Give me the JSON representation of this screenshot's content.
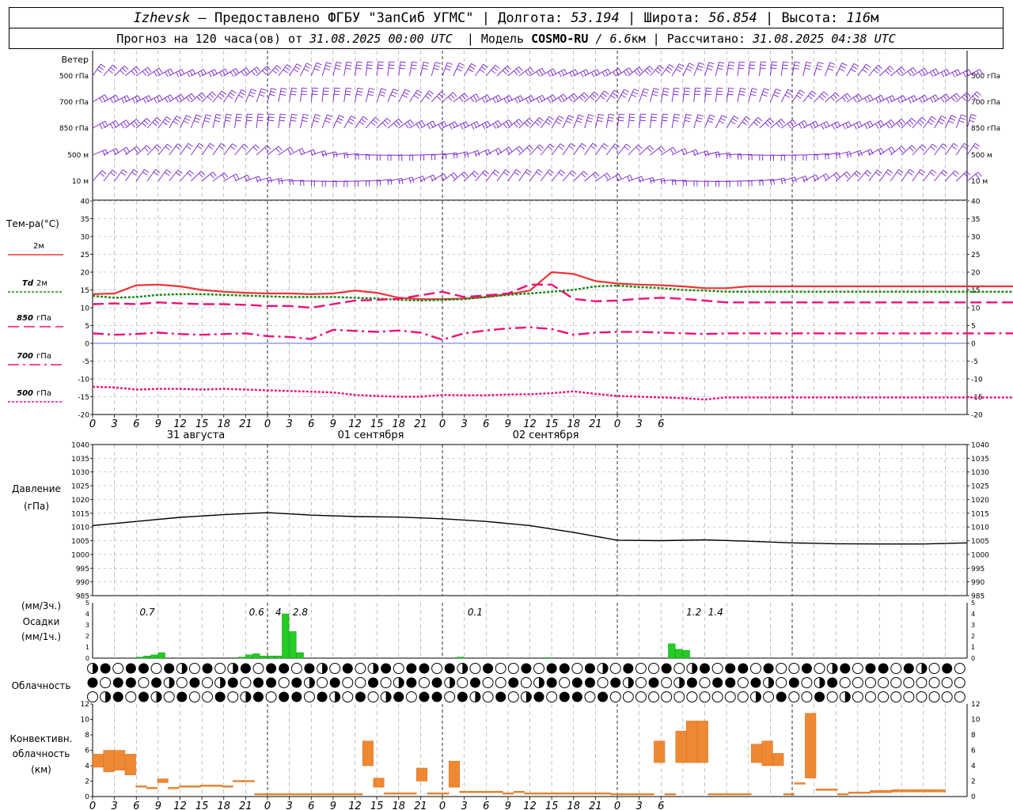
{
  "header": {
    "city": "Izhevsk",
    "provider": "— Предоставлено ФГБУ \"ЗапСиб УГМС\" | Долгота:",
    "lon": "53.194",
    "lat_label": "| Широта:",
    "lat": "56.854",
    "alt_label": "| Высота:",
    "alt": "116",
    "alt_unit": "м",
    "forecast_label": "Прогноз на 120 часа(ов) от",
    "forecast_time": "31.08.2025 00:00 UTC",
    "model_label": "| Модель",
    "model": "COSMO-RU",
    "model_res": "/ 6.6",
    "model_res_unit": "км",
    "computed_label": "| Рассчитано:",
    "computed_time": "31.08.2025 04:38 UTC"
  },
  "colors": {
    "t2m": "#ee3333",
    "td": "#118811",
    "t850": "#ee1177",
    "t700": "#ee1177",
    "t500": "#ee1177",
    "wind": "#7722cc",
    "precip": "#22cc22",
    "conv": "#ee8833",
    "pressure": "#000000",
    "grid": "#999999"
  },
  "chart_data": [
    {
      "type": "wind-barbs",
      "title": "Ветер",
      "levels": [
        "500 гПа",
        "700 гПа",
        "850 гПа",
        "500 м",
        "10 м"
      ]
    },
    {
      "type": "line",
      "title": "Тем-ра(°C)",
      "ylim": [
        -20,
        40
      ],
      "yticks": [
        40,
        35,
        30,
        25,
        20,
        15,
        10,
        5,
        0,
        -5,
        -10,
        -15,
        -20
      ],
      "x_ticks": [
        "0",
        "3",
        "6",
        "9",
        "12",
        "15",
        "18",
        "21",
        "0",
        "3",
        "6",
        "9",
        "12",
        "15",
        "18",
        "21",
        "0",
        "3",
        "6",
        "9",
        "12",
        "15",
        "18",
        "21",
        "0",
        "3",
        "6"
      ],
      "day_labels": [
        "31 августа",
        "01 сентября",
        "02 сентября"
      ],
      "legend": [
        {
          "key": "t2m",
          "label": "2м",
          "label_prefix": ""
        },
        {
          "key": "td",
          "label": "2м",
          "label_prefix": "Td"
        },
        {
          "key": "t850",
          "label": "гПа",
          "label_prefix": "850"
        },
        {
          "key": "t700",
          "label": "гПа",
          "label_prefix": "700"
        },
        {
          "key": "t500",
          "label": "гПа",
          "label_prefix": "500"
        }
      ],
      "x_hours": [
        0,
        3,
        6,
        9,
        12,
        15,
        18,
        21,
        24,
        27,
        30,
        33,
        36,
        39,
        42,
        45,
        48,
        51,
        54,
        57,
        60,
        63,
        66,
        69,
        72,
        75,
        78,
        81,
        84,
        87,
        90,
        93,
        96,
        99,
        102,
        105,
        108,
        111,
        114,
        117,
        120,
        123,
        126,
        129,
        132,
        135,
        138,
        141,
        144,
        147,
        150,
        153,
        156,
        159
      ],
      "series": [
        {
          "key": "t2m",
          "name": "2м",
          "values": [
            13.8,
            14.0,
            16.3,
            16.5,
            16.0,
            15.0,
            14.5,
            14.2,
            14.0,
            14.0,
            13.8,
            14.0,
            14.8,
            14.2,
            12.8,
            12.4,
            12.4,
            12.6,
            13.0,
            13.8,
            14.8,
            20.0,
            19.5,
            17.5,
            16.8,
            16.5,
            16.3,
            16.0,
            15.5,
            15.5,
            16.0,
            16.0,
            16.0,
            16.0,
            16.0,
            16.0,
            16.0,
            16.0,
            16.0,
            16.0,
            16.0,
            16.0,
            16.0,
            16.0,
            16.0,
            16.0,
            16.0,
            16.0,
            16.0,
            16.0,
            16.0,
            16.0,
            16.0,
            16.0
          ]
        },
        {
          "key": "td",
          "name": "Td 2м",
          "values": [
            13.3,
            12.8,
            13.0,
            13.6,
            13.8,
            13.8,
            13.6,
            13.4,
            13.2,
            13.0,
            13.0,
            13.0,
            12.8,
            12.6,
            12.2,
            12.0,
            12.2,
            12.4,
            13.0,
            13.6,
            14.0,
            14.5,
            15.0,
            16.0,
            16.2,
            15.8,
            15.5,
            15.0,
            14.8,
            14.5,
            14.5,
            14.5,
            14.5,
            14.5,
            14.5,
            14.5,
            14.5,
            14.5,
            14.5,
            14.5,
            14.5,
            14.5,
            14.5,
            14.5,
            14.5,
            14.5,
            14.5,
            14.5,
            14.5,
            14.5,
            14.5,
            14.5,
            14.5,
            14.5
          ]
        },
        {
          "key": "t850",
          "name": "850 гПа",
          "values": [
            11.0,
            11.2,
            11.0,
            11.5,
            11.2,
            11.0,
            11.0,
            10.8,
            10.5,
            10.5,
            10.0,
            11.0,
            12.0,
            12.2,
            12.5,
            13.5,
            14.5,
            13.0,
            13.5,
            14.0,
            16.5,
            16.5,
            12.5,
            11.8,
            12.0,
            12.5,
            12.8,
            12.5,
            12.0,
            11.5,
            11.5,
            11.5,
            11.5,
            11.5,
            11.5,
            11.5,
            11.5,
            11.5,
            11.5,
            11.5,
            11.5,
            11.5,
            11.5,
            11.5,
            11.5,
            11.5,
            11.5,
            11.5,
            11.5,
            11.5,
            11.5,
            11.5,
            11.5,
            11.5
          ]
        },
        {
          "key": "t700",
          "name": "700 гПа",
          "values": [
            2.8,
            2.4,
            2.6,
            3.0,
            2.6,
            2.4,
            2.6,
            2.8,
            2.0,
            1.8,
            1.2,
            3.8,
            3.5,
            3.2,
            3.6,
            3.0,
            1.0,
            2.8,
            3.6,
            4.2,
            4.5,
            4.0,
            2.4,
            3.0,
            3.2,
            3.2,
            3.0,
            2.8,
            2.6,
            2.8,
            2.8,
            2.8,
            2.8,
            2.8,
            2.8,
            2.8,
            2.8,
            2.8,
            2.8,
            2.8,
            2.8,
            2.8,
            2.8,
            2.8,
            2.8,
            2.8,
            2.8,
            2.8,
            2.8,
            2.8,
            2.8,
            2.8,
            2.8,
            2.8
          ]
        },
        {
          "key": "t500",
          "name": "500 гПа",
          "values": [
            -12.2,
            -12.4,
            -13.0,
            -12.8,
            -12.8,
            -13.0,
            -12.8,
            -13.0,
            -13.2,
            -13.4,
            -13.6,
            -13.8,
            -14.5,
            -14.8,
            -15.0,
            -15.0,
            -14.5,
            -14.6,
            -14.6,
            -14.4,
            -14.3,
            -14.0,
            -13.5,
            -14.2,
            -14.8,
            -15.0,
            -15.2,
            -15.4,
            -15.8,
            -15.2,
            -15.2,
            -15.2,
            -15.2,
            -15.2,
            -15.2,
            -15.2,
            -15.2,
            -15.2,
            -15.2,
            -15.2,
            -15.2,
            -15.2,
            -15.2,
            -15.2,
            -15.2,
            -15.2,
            -15.2,
            -15.2,
            -15.2,
            -15.2,
            -15.2,
            -15.2,
            -15.2,
            -15.2
          ]
        }
      ]
    },
    {
      "type": "line",
      "title": "Давление",
      "unit": "(гПа)",
      "ylim": [
        985,
        1040
      ],
      "yticks": [
        1040,
        1035,
        1030,
        1025,
        1020,
        1015,
        1010,
        1005,
        1000,
        995,
        990,
        985
      ],
      "x_hours": [
        0,
        6,
        12,
        18,
        24,
        30,
        36,
        42,
        48,
        54,
        60,
        66,
        72,
        78,
        84,
        90,
        96,
        102,
        108,
        114,
        120
      ],
      "values": [
        1010.5,
        1012.0,
        1013.5,
        1014.5,
        1015.2,
        1014.3,
        1013.8,
        1013.6,
        1013.0,
        1012.0,
        1010.5,
        1008.0,
        1005.2,
        1005.0,
        1005.3,
        1004.8,
        1004.2,
        1003.9,
        1003.8,
        1003.8,
        1004.2
      ]
    },
    {
      "type": "bar",
      "title": "Осадки",
      "units": [
        "(мм/3ч.)",
        "(мм/1ч.)"
      ],
      "ylim": [
        0,
        5
      ],
      "yticks": [
        5,
        4,
        3,
        2,
        1,
        0
      ],
      "annotations": [
        {
          "hour": 7.5,
          "text": "0.7"
        },
        {
          "hour": 22.5,
          "text": "0.6"
        },
        {
          "hour": 25.5,
          "text": "4"
        },
        {
          "hour": 28.5,
          "text": "2.8"
        },
        {
          "hour": 52.5,
          "text": "0.1"
        },
        {
          "hour": 82.5,
          "text": "1.2"
        },
        {
          "hour": 85.5,
          "text": "1.4"
        }
      ],
      "bars": [
        {
          "hour": 6,
          "value": 0.1
        },
        {
          "hour": 7,
          "value": 0.2
        },
        {
          "hour": 8,
          "value": 0.3
        },
        {
          "hour": 9,
          "value": 0.5
        },
        {
          "hour": 20,
          "value": 0.1
        },
        {
          "hour": 21,
          "value": 0.3
        },
        {
          "hour": 22,
          "value": 0.4
        },
        {
          "hour": 23,
          "value": 0.2
        },
        {
          "hour": 24,
          "value": 0.2
        },
        {
          "hour": 25,
          "value": 0.2
        },
        {
          "hour": 26,
          "value": 4.0
        },
        {
          "hour": 27,
          "value": 2.4
        },
        {
          "hour": 28,
          "value": 0.5
        },
        {
          "hour": 50,
          "value": 0.1
        },
        {
          "hour": 62,
          "value": 0.05
        },
        {
          "hour": 79,
          "value": 1.3
        },
        {
          "hour": 80,
          "value": 0.8
        },
        {
          "hour": 81,
          "value": 0.7
        }
      ]
    },
    {
      "type": "cloud-symbols",
      "title": "Облачность",
      "levels": 3
    },
    {
      "type": "bar",
      "title": "Конвективн.",
      "title2": "облачность",
      "unit": "(км)",
      "ylim": [
        0,
        12
      ],
      "yticks": [
        12,
        10,
        8,
        6,
        4,
        2,
        0
      ],
      "bars": [
        {
          "hour": 0,
          "bottom": 3.8,
          "top": 5.5
        },
        {
          "hour": 1,
          "bottom": 3.2,
          "top": 6.0
        },
        {
          "hour": 2,
          "bottom": 3.4,
          "top": 6.0
        },
        {
          "hour": 3,
          "bottom": 2.8,
          "top": 5.5
        },
        {
          "hour": 4,
          "bottom": 1.2,
          "top": 1.4
        },
        {
          "hour": 5,
          "bottom": 1.0,
          "top": 1.2
        },
        {
          "hour": 6,
          "bottom": 1.8,
          "top": 2.3
        },
        {
          "hour": 7,
          "bottom": 1.0,
          "top": 1.2
        },
        {
          "hour": 8,
          "bottom": 1.2,
          "top": 1.4
        },
        {
          "hour": 9,
          "bottom": 1.2,
          "top": 1.4
        },
        {
          "hour": 10,
          "bottom": 1.3,
          "top": 1.5
        },
        {
          "hour": 11,
          "bottom": 1.3,
          "top": 1.5
        },
        {
          "hour": 12,
          "bottom": 1.2,
          "top": 1.4
        },
        {
          "hour": 13,
          "bottom": 1.9,
          "top": 2.1
        },
        {
          "hour": 14,
          "bottom": 1.9,
          "top": 2.1
        },
        {
          "hour": 15,
          "bottom": 0.2,
          "top": 0.4
        },
        {
          "hour": 16,
          "bottom": 0.2,
          "top": 0.4
        },
        {
          "hour": 17,
          "bottom": 0.2,
          "top": 0.4
        },
        {
          "hour": 18,
          "bottom": 0.2,
          "top": 0.4
        },
        {
          "hour": 19,
          "bottom": 0.2,
          "top": 0.4
        },
        {
          "hour": 20,
          "bottom": 0.2,
          "top": 0.4
        },
        {
          "hour": 21,
          "bottom": 0.2,
          "top": 0.4
        },
        {
          "hour": 22,
          "bottom": 0.2,
          "top": 0.4
        },
        {
          "hour": 23,
          "bottom": 0.2,
          "top": 0.4
        },
        {
          "hour": 24,
          "bottom": 0.2,
          "top": 0.4
        },
        {
          "hour": 25,
          "bottom": 4.0,
          "top": 7.2
        },
        {
          "hour": 26,
          "bottom": 1.2,
          "top": 2.4
        },
        {
          "hour": 27,
          "bottom": 0.3,
          "top": 0.5
        },
        {
          "hour": 28,
          "bottom": 0.3,
          "top": 0.5
        },
        {
          "hour": 29,
          "bottom": 0.3,
          "top": 0.5
        },
        {
          "hour": 30,
          "bottom": 2.0,
          "top": 3.7
        },
        {
          "hour": 31,
          "bottom": 0.3,
          "top": 0.5
        },
        {
          "hour": 32,
          "bottom": 0.3,
          "top": 0.5
        },
        {
          "hour": 33,
          "bottom": 1.2,
          "top": 4.6
        },
        {
          "hour": 34,
          "bottom": 0.5,
          "top": 0.7
        },
        {
          "hour": 35,
          "bottom": 0.5,
          "top": 0.7
        },
        {
          "hour": 36,
          "bottom": 0.5,
          "top": 0.7
        },
        {
          "hour": 37,
          "bottom": 0.5,
          "top": 0.7
        },
        {
          "hour": 38,
          "bottom": 0.3,
          "top": 0.5
        },
        {
          "hour": 39,
          "bottom": 0.5,
          "top": 0.7
        },
        {
          "hour": 40,
          "bottom": 0.3,
          "top": 0.5
        },
        {
          "hour": 41,
          "bottom": 0.3,
          "top": 0.5
        },
        {
          "hour": 42,
          "bottom": 0.3,
          "top": 0.5
        },
        {
          "hour": 43,
          "bottom": 0.3,
          "top": 0.5
        },
        {
          "hour": 44,
          "bottom": 0.3,
          "top": 0.5
        },
        {
          "hour": 45,
          "bottom": 0.3,
          "top": 0.5
        },
        {
          "hour": 46,
          "bottom": 0.3,
          "top": 0.5
        },
        {
          "hour": 47,
          "bottom": 0.3,
          "top": 0.5
        },
        {
          "hour": 48,
          "bottom": 0.2,
          "top": 0.4
        },
        {
          "hour": 49,
          "bottom": 0.2,
          "top": 0.4
        },
        {
          "hour": 50,
          "bottom": 0.2,
          "top": 0.4
        },
        {
          "hour": 51,
          "bottom": 0.2,
          "top": 0.4
        },
        {
          "hour": 52,
          "bottom": 4.4,
          "top": 7.2
        },
        {
          "hour": 53,
          "bottom": 0.2,
          "top": 0.4
        },
        {
          "hour": 54,
          "bottom": 4.4,
          "top": 8.5
        },
        {
          "hour": 55,
          "bottom": 4.4,
          "top": 9.8
        },
        {
          "hour": 56,
          "bottom": 4.4,
          "top": 9.8
        },
        {
          "hour": 57,
          "bottom": 0.2,
          "top": 0.4
        },
        {
          "hour": 58,
          "bottom": 0.2,
          "top": 0.4
        },
        {
          "hour": 59,
          "bottom": 0.2,
          "top": 0.4
        },
        {
          "hour": 60,
          "bottom": 0.2,
          "top": 0.4
        },
        {
          "hour": 61,
          "bottom": 4.4,
          "top": 6.8
        },
        {
          "hour": 62,
          "bottom": 4.0,
          "top": 7.2
        },
        {
          "hour": 63,
          "bottom": 4.0,
          "top": 5.6
        },
        {
          "hour": 64,
          "bottom": 0.2,
          "top": 0.4
        },
        {
          "hour": 65,
          "bottom": 1.6,
          "top": 1.8
        },
        {
          "hour": 66,
          "bottom": 2.4,
          "top": 10.8
        },
        {
          "hour": 67,
          "bottom": 0.8,
          "top": 1.0
        },
        {
          "hour": 68,
          "bottom": 0.8,
          "top": 1.0
        },
        {
          "hour": 69,
          "bottom": 0.2,
          "top": 0.4
        },
        {
          "hour": 70,
          "bottom": 0.4,
          "top": 0.6
        },
        {
          "hour": 71,
          "bottom": 0.4,
          "top": 0.6
        },
        {
          "hour": 72,
          "bottom": 0.5,
          "top": 0.8
        },
        {
          "hour": 73,
          "bottom": 0.5,
          "top": 0.8
        },
        {
          "hour": 74,
          "bottom": 0.6,
          "top": 0.9
        },
        {
          "hour": 75,
          "bottom": 0.6,
          "top": 0.9
        },
        {
          "hour": 76,
          "bottom": 0.6,
          "top": 0.9
        },
        {
          "hour": 77,
          "bottom": 0.6,
          "top": 0.9
        },
        {
          "hour": 78,
          "bottom": 0.6,
          "top": 0.9
        }
      ]
    }
  ]
}
